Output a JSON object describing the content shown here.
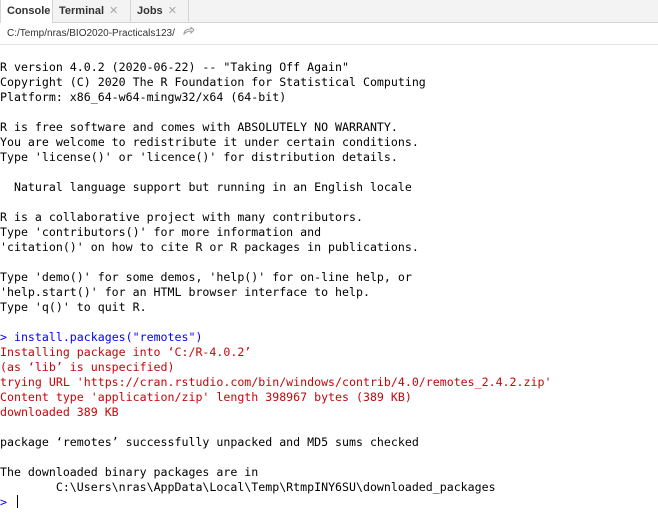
{
  "tabs": [
    {
      "label": "Console",
      "active": true,
      "closable": false
    },
    {
      "label": "Terminal",
      "active": false,
      "closable": true
    },
    {
      "label": "Jobs",
      "active": false,
      "closable": true
    }
  ],
  "path": {
    "text": "C:/Temp/nras/BIO2020-Practicals123/",
    "icon": "go-to-directory-icon"
  },
  "console": {
    "startup": [
      "R version 4.0.2 (2020-06-22) -- \"Taking Off Again\"",
      "Copyright (C) 2020 The R Foundation for Statistical Computing",
      "Platform: x86_64-w64-mingw32/x64 (64-bit)",
      "",
      "R is free software and comes with ABSOLUTELY NO WARRANTY.",
      "You are welcome to redistribute it under certain conditions.",
      "Type 'license()' or 'licence()' for distribution details.",
      "",
      "  Natural language support but running in an English locale",
      "",
      "R is a collaborative project with many contributors.",
      "Type 'contributors()' for more information and",
      "'citation()' on how to cite R or R packages in publications.",
      "",
      "Type 'demo()' for some demos, 'help()' for on-line help, or",
      "'help.start()' for an HTML browser interface to help.",
      "Type 'q()' to quit R.",
      ""
    ],
    "prompt": ">",
    "command": "install.packages(\"remotes\")",
    "messages": [
      "Installing package into ‘C:/R-4.0.2’",
      "(as ‘lib’ is unspecified)",
      "trying URL 'https://cran.rstudio.com/bin/windows/contrib/4.0/remotes_2.4.2.zip'",
      "Content type 'application/zip' length 398967 bytes (389 KB)",
      "downloaded 389 KB"
    ],
    "output": [
      "",
      "package ‘remotes’ successfully unpacked and MD5 sums checked",
      "",
      "The downloaded binary packages are in",
      "\tC:\\Users\\nras\\AppData\\Local\\Temp\\RtmpINY6SU\\downloaded_packages"
    ],
    "input_value": ""
  },
  "colors": {
    "prompt": "#0000ff",
    "error_text": "#c5060b",
    "normal_text": "#000000"
  }
}
